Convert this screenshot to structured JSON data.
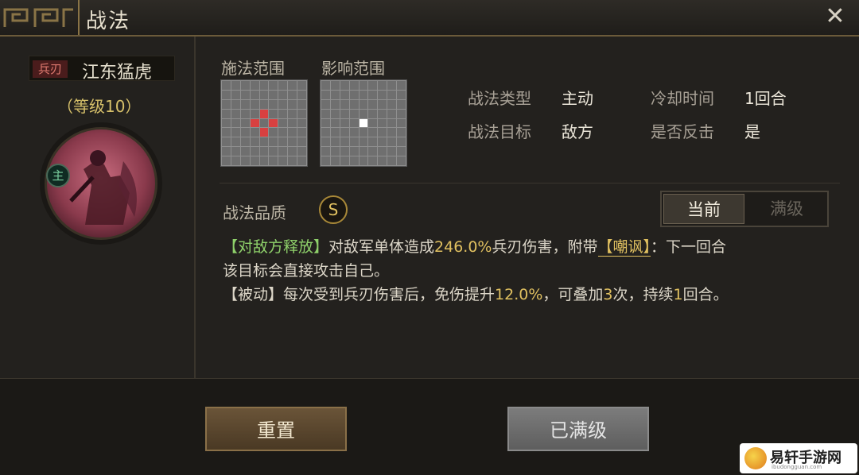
{
  "window": {
    "title": "战法"
  },
  "hero": {
    "weapon_tag": "兵刃",
    "name": "江东猛虎",
    "level": "（等级10）",
    "role_badge": "主"
  },
  "ranges": {
    "cast_label": "施法范围",
    "effect_label": "影响范围"
  },
  "info": {
    "type_label": "战法类型",
    "type_value": "主动",
    "target_label": "战法目标",
    "target_value": "敌方",
    "cooldown_label": "冷却时间",
    "cooldown_value": "1回合",
    "counter_label": "是否反击",
    "counter_value": "是"
  },
  "quality": {
    "label": "战法品质",
    "grade": "S"
  },
  "tabs": {
    "current": "当前",
    "max": "满级"
  },
  "description": {
    "line1_tag": "【对敌方释放】",
    "line1_a": "对敌军单体造成",
    "line1_pct": "246.0%",
    "line1_b": "兵刃伤害，附带",
    "line1_status": "【嘲讽】",
    "line1_c": "：下一回合",
    "line2": "该目标会直接攻击自己。",
    "line3_tag": "【被动】",
    "line3_a": "每次受到兵刃伤害后，免伤提升",
    "line3_pct": "12.0%",
    "line3_b": "，可叠加",
    "line3_stack": "3",
    "line3_c": "次，持续",
    "line3_dur": "1",
    "line3_d": "回合。"
  },
  "buttons": {
    "reset": "重置",
    "maxed": "已满级"
  },
  "watermark": {
    "text": "易轩手游网",
    "sub": "ibudongguan.com"
  }
}
